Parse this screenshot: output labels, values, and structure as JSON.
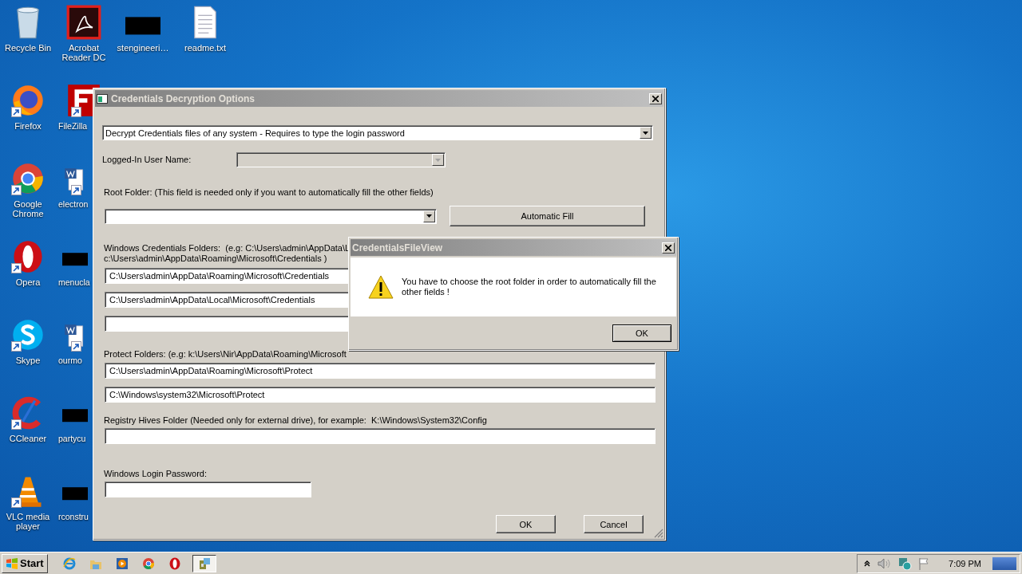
{
  "desktop_icon_columns": [
    {
      "icons": [
        {
          "label": "Recycle Bin",
          "kind": "recycle-bin"
        },
        {
          "label": "Firefox",
          "kind": "firefox"
        },
        {
          "label": "Google Chrome",
          "kind": "chrome"
        },
        {
          "label": "Opera",
          "kind": "opera"
        },
        {
          "label": "Skype",
          "kind": "skype"
        },
        {
          "label": "CCleaner",
          "kind": "ccleaner"
        },
        {
          "label": "VLC media player",
          "kind": "vlc"
        }
      ]
    },
    {
      "icons": [
        {
          "label": "Acrobat Reader DC",
          "kind": "acrobat"
        },
        {
          "label": "FileZilla",
          "kind": "filezilla"
        },
        {
          "label": "electron",
          "kind": "word"
        },
        {
          "label": "menucla",
          "kind": "redacted"
        },
        {
          "label": "ourmo",
          "kind": "word"
        },
        {
          "label": "partycu",
          "kind": "redacted"
        },
        {
          "label": "rconstru",
          "kind": "redacted"
        }
      ]
    },
    {
      "icons": [
        {
          "label": "stengineeri…",
          "kind": "redacted"
        }
      ]
    },
    {
      "icons": [
        {
          "label": "readme.txt",
          "kind": "text-file"
        }
      ]
    }
  ],
  "main_window": {
    "title": "Credentials Decryption Options",
    "mode_select": "Decrypt Credentials files of any system - Requires to type the login password",
    "user_name": {
      "label": "Logged-In User Name:",
      "disabled": true
    },
    "root_folder_label": "Root Folder: (This field is needed only if you want to automatically fill the other fields)",
    "automatic_fill_button": "Automatic Fill",
    "credentials_label_lines": [
      "Windows Credentials Folders:  (e.g: C:\\Users\\admin\\AppData\\L",
      "c:\\Users\\admin\\AppData\\Roaming\\Microsoft\\Credentials )"
    ],
    "credential_folders": [
      {
        "value": "C:\\Users\\admin\\AppData\\Roaming\\Microsoft\\Credentials"
      },
      {
        "value": "C:\\Users\\admin\\AppData\\Local\\Microsoft\\Credentials"
      }
    ],
    "protect_label": "Protect Folders: (e.g: k:\\Users\\Nir\\AppData\\Roaming\\Microsoft",
    "protect_folders": [
      {
        "value": "C:\\Users\\admin\\AppData\\Roaming\\Microsoft\\Protect"
      },
      {
        "value": "C:\\Windows\\system32\\Microsoft\\Protect"
      }
    ],
    "registry_label": "Registry Hives Folder (Needed only for external drive), for example:  K:\\Windows\\System32\\Config",
    "password_label": "Windows Login Password:",
    "buttons": [
      "OK",
      "Cancel"
    ]
  },
  "dialog": {
    "title": "CredentialsFileView",
    "message": "You have to choose the root folder in order to automatically fill the other fields !",
    "button": "OK"
  },
  "taskbar": {
    "start_label": "Start",
    "apps": [
      {
        "kind": "ie",
        "selected": false
      },
      {
        "kind": "explorer",
        "selected": false
      },
      {
        "kind": "media",
        "selected": false
      },
      {
        "kind": "chrome",
        "selected": false
      },
      {
        "kind": "opera",
        "selected": false
      },
      {
        "kind": "app",
        "selected": true
      }
    ],
    "time": "7:09 PM"
  }
}
